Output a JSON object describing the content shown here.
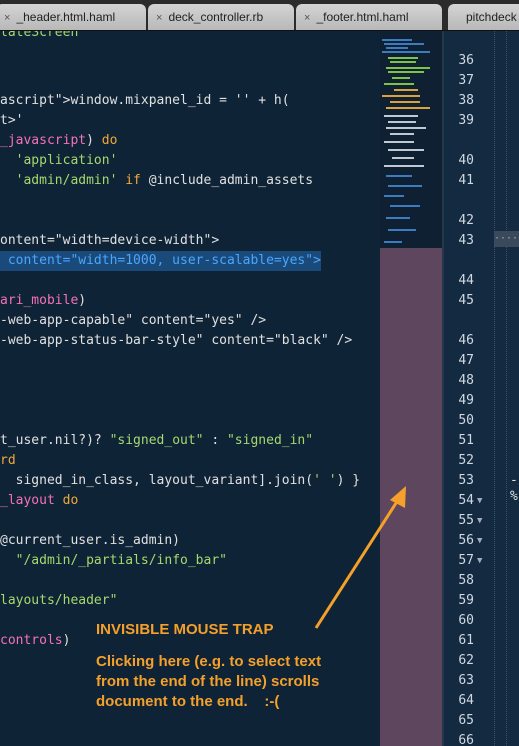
{
  "tabs": [
    {
      "label": "_header.html.haml",
      "close": "×"
    },
    {
      "label": "deck_controller.rb",
      "close": "×"
    },
    {
      "label": "_footer.html.haml",
      "close": "×"
    },
    {
      "label": "pitchdeck",
      "close": ""
    }
  ],
  "code_lines": [
    {
      "segments": [
        {
          "t": "ascript\">window.mixpanel_id = '' + h(",
          "c": ""
        }
      ]
    },
    {
      "segments": [
        {
          "t": "t>'",
          "c": ""
        }
      ]
    },
    {
      "segments": [
        {
          "t": "_javascript",
          "c": "pink"
        },
        {
          "t": ") ",
          "c": ""
        },
        {
          "t": "do",
          "c": "kw"
        }
      ]
    },
    {
      "segments": [
        {
          "t": "  'application'",
          "c": "str"
        }
      ]
    },
    {
      "segments": [
        {
          "t": "  'admin/admin'",
          "c": "str"
        },
        {
          "t": " if ",
          "c": "kw"
        },
        {
          "t": "@include_admin_assets",
          "c": ""
        }
      ]
    },
    {
      "segments": [
        {
          "t": "ontent=\"width=device-width\">",
          "c": ""
        }
      ]
    },
    {
      "segments": [
        {
          "t": " content=\"width=1000, user-scalable=yes\">",
          "c": "blue"
        }
      ]
    },
    {
      "segments": [
        {
          "t": "ari_mobile",
          "c": "pink"
        },
        {
          "t": ")",
          "c": ""
        }
      ]
    },
    {
      "segments": [
        {
          "t": "-web-app-capable\" content=\"yes\" />",
          "c": ""
        }
      ]
    },
    {
      "segments": [
        {
          "t": "-web-app-status-bar-style\" content=\"black\" />",
          "c": ""
        }
      ]
    },
    {
      "segments": [
        {
          "t": "t_user.nil?)? ",
          "c": ""
        },
        {
          "t": "\"signed_out\"",
          "c": "str"
        },
        {
          "t": " : ",
          "c": ""
        },
        {
          "t": "\"signed_in\"",
          "c": "str"
        }
      ]
    },
    {
      "segments": [
        {
          "t": "rd",
          "c": "kw"
        }
      ]
    },
    {
      "segments": [
        {
          "t": "  signed_in_class, layout_variant].join(",
          "c": ""
        },
        {
          "t": "' '",
          "c": "str"
        },
        {
          "t": ") }",
          "c": ""
        }
      ]
    },
    {
      "segments": [
        {
          "t": "_layout",
          "c": "pink"
        },
        {
          "t": " do",
          "c": "kw"
        }
      ]
    },
    {
      "segments": [
        {
          "t": "@current_user.is_admin)",
          "c": ""
        }
      ]
    },
    {
      "segments": [
        {
          "t": "  ",
          "c": ""
        },
        {
          "t": "\"/admin/_partials/info_bar\"",
          "c": "str"
        }
      ]
    },
    {
      "segments": [
        {
          "t": "layouts/header\"",
          "c": "str"
        }
      ]
    },
    {
      "segments": [
        {
          "t": "controls",
          "c": "pink"
        },
        {
          "t": ")",
          "c": ""
        }
      ]
    }
  ],
  "line_numbers": [
    {
      "n": "36",
      "fold": ""
    },
    {
      "n": "37",
      "fold": ""
    },
    {
      "n": "38",
      "fold": ""
    },
    {
      "n": "39",
      "fold": ""
    },
    {
      "n": "40",
      "fold": ""
    },
    {
      "n": "41",
      "fold": ""
    },
    {
      "n": "42",
      "fold": ""
    },
    {
      "n": "43",
      "fold": ""
    },
    {
      "n": "44",
      "fold": ""
    },
    {
      "n": "45",
      "fold": ""
    },
    {
      "n": "46",
      "fold": ""
    },
    {
      "n": "47",
      "fold": ""
    },
    {
      "n": "48",
      "fold": ""
    },
    {
      "n": "49",
      "fold": ""
    },
    {
      "n": "50",
      "fold": ""
    },
    {
      "n": "51",
      "fold": ""
    },
    {
      "n": "52",
      "fold": ""
    },
    {
      "n": "53",
      "fold": ""
    },
    {
      "n": "54",
      "fold": "▼"
    },
    {
      "n": "55",
      "fold": "▼"
    },
    {
      "n": "56",
      "fold": "▼"
    },
    {
      "n": "57",
      "fold": "▼"
    },
    {
      "n": "58",
      "fold": ""
    },
    {
      "n": "59",
      "fold": ""
    },
    {
      "n": "60",
      "fold": ""
    },
    {
      "n": "61",
      "fold": ""
    },
    {
      "n": "62",
      "fold": ""
    },
    {
      "n": "63",
      "fold": ""
    },
    {
      "n": "64",
      "fold": ""
    },
    {
      "n": "65",
      "fold": ""
    },
    {
      "n": "66",
      "fold": ""
    }
  ],
  "right_pane_snippets": [
    "·····",
    "-",
    "%"
  ],
  "annotation": {
    "title": "INVISIBLE MOUSE TRAP",
    "body_lines": [
      "Clicking here (e.g. to select text",
      "from the end of the line) scrolls",
      "document to the end.    :-("
    ]
  },
  "colors": {
    "annotation": "#f5a02a",
    "trap": "#6b4e66",
    "editor_bg": "#0f2336"
  }
}
